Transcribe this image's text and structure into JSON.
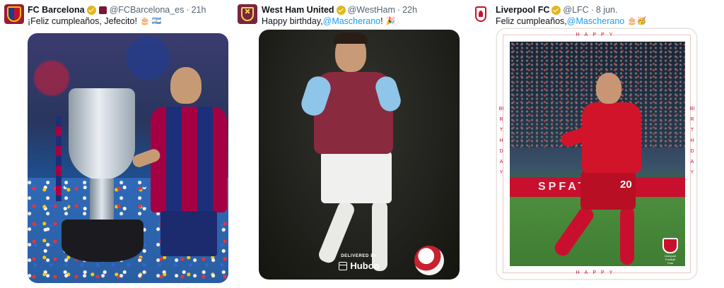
{
  "tweets": [
    {
      "name": "FC Barcelona",
      "handle": "@FCBarcelona_es",
      "dot": "·",
      "time": "21h",
      "text": "¡Feliz cumpleaños, Jefecito!",
      "emoji": "🎂 🇦🇷"
    },
    {
      "name": "West Ham United",
      "handle": "@WestHam",
      "dot": "·",
      "time": "22h",
      "text_prefix": "Happy birthday, ",
      "mention": "@Mascherano",
      "text_suffix": "!",
      "emoji": "🎉",
      "delivered_by": "DELIVERED BY",
      "sponsor": "Huboo"
    },
    {
      "name": "Liverpool FC",
      "handle": "@LFC",
      "dot": "·",
      "time": "8 jun.",
      "text_prefix": "Feliz cumpleaños, ",
      "mention": "@Mascherano",
      "emoji": "🎂🥳",
      "card_top": "HAPPY",
      "card_bottom": "HAPPY",
      "card_left": "BIRTHDAY",
      "card_right": "BIRTHDAY",
      "ad_board": "SPFAT",
      "shirt_number": "20",
      "badge_text": "Liverpool Football Club"
    }
  ]
}
